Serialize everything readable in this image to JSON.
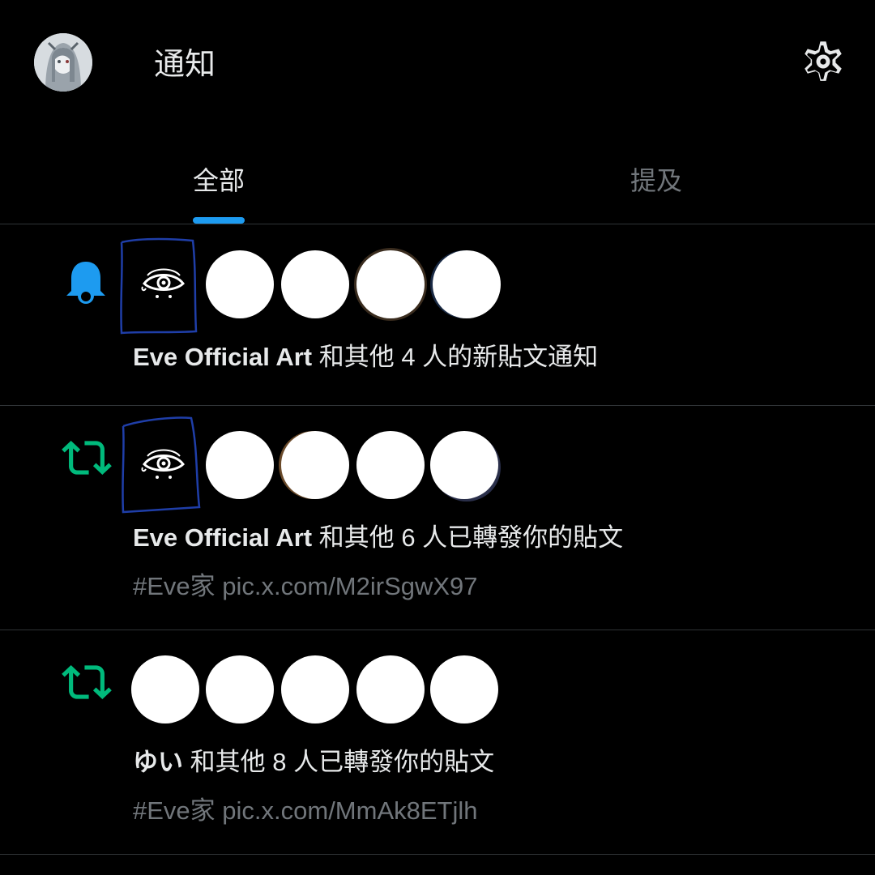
{
  "header": {
    "title": "通知",
    "avatar_icon": "user-avatar",
    "settings_icon": "gear-icon"
  },
  "tabs": [
    {
      "label": "全部",
      "active": true
    },
    {
      "label": "提及",
      "active": false
    }
  ],
  "colors": {
    "accent": "#1d9bf0",
    "retweet": "#00ba7c",
    "muted": "#71767b"
  },
  "notifications": [
    {
      "type_icon": "bell-icon",
      "name": "Eve Official Art",
      "text": " 和其他 4 人的新貼文通知",
      "sub": ""
    },
    {
      "type_icon": "retweet-icon",
      "name": "Eve Official Art",
      "text": " 和其他 6 人已轉發你的貼文",
      "sub": "#Eve家 pic.x.com/M2irSgwX97"
    },
    {
      "type_icon": "retweet-icon",
      "name": "ゆい",
      "text": " 和其他 8 人已轉發你的貼文",
      "sub": "#Eve家 pic.x.com/MmAk8ETjlh"
    }
  ]
}
